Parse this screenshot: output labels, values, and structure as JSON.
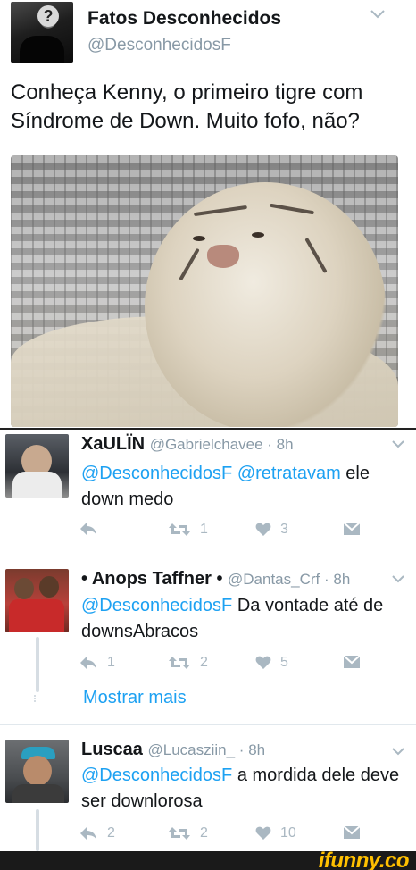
{
  "main_tweet": {
    "name": "Fatos Desconhecidos",
    "handle": "@DesconhecidosF",
    "text": "Conheça Kenny, o primeiro tigre com Síndrome de Down. Muito fofo, não?"
  },
  "replies": [
    {
      "name": "XaULÏN",
      "meta": "@Gabrielchavee · 8h",
      "mention1": "@DesconhecidosF",
      "mention2": "@retratavam",
      "text": " ele down medo",
      "reply_count": "",
      "retweet_count": "1",
      "like_count": "3"
    },
    {
      "name": "• Anops Taffner •",
      "meta": "@Dantas_Crf · 8h",
      "mention1": "@DesconhecidosF",
      "text": " Da vontade até de downsAbracos",
      "reply_count": "1",
      "retweet_count": "2",
      "like_count": "5",
      "show_more": "Mostrar mais"
    },
    {
      "name": "Luscaa",
      "meta": "@Lucasziin_ · 8h",
      "mention1": "@DesconhecidosF",
      "text": " a mordida dele deve ser downlorosa",
      "reply_count": "2",
      "retweet_count": "2",
      "like_count": "10"
    }
  ],
  "watermark": "ifunny.co",
  "colors": {
    "link": "#1da1f2",
    "muted": "#8899a6",
    "action": "#aab8c2",
    "watermark": "#ffc000"
  },
  "icons": [
    "chevron-down-icon",
    "reply-icon",
    "retweet-icon",
    "like-icon",
    "dm-icon"
  ]
}
